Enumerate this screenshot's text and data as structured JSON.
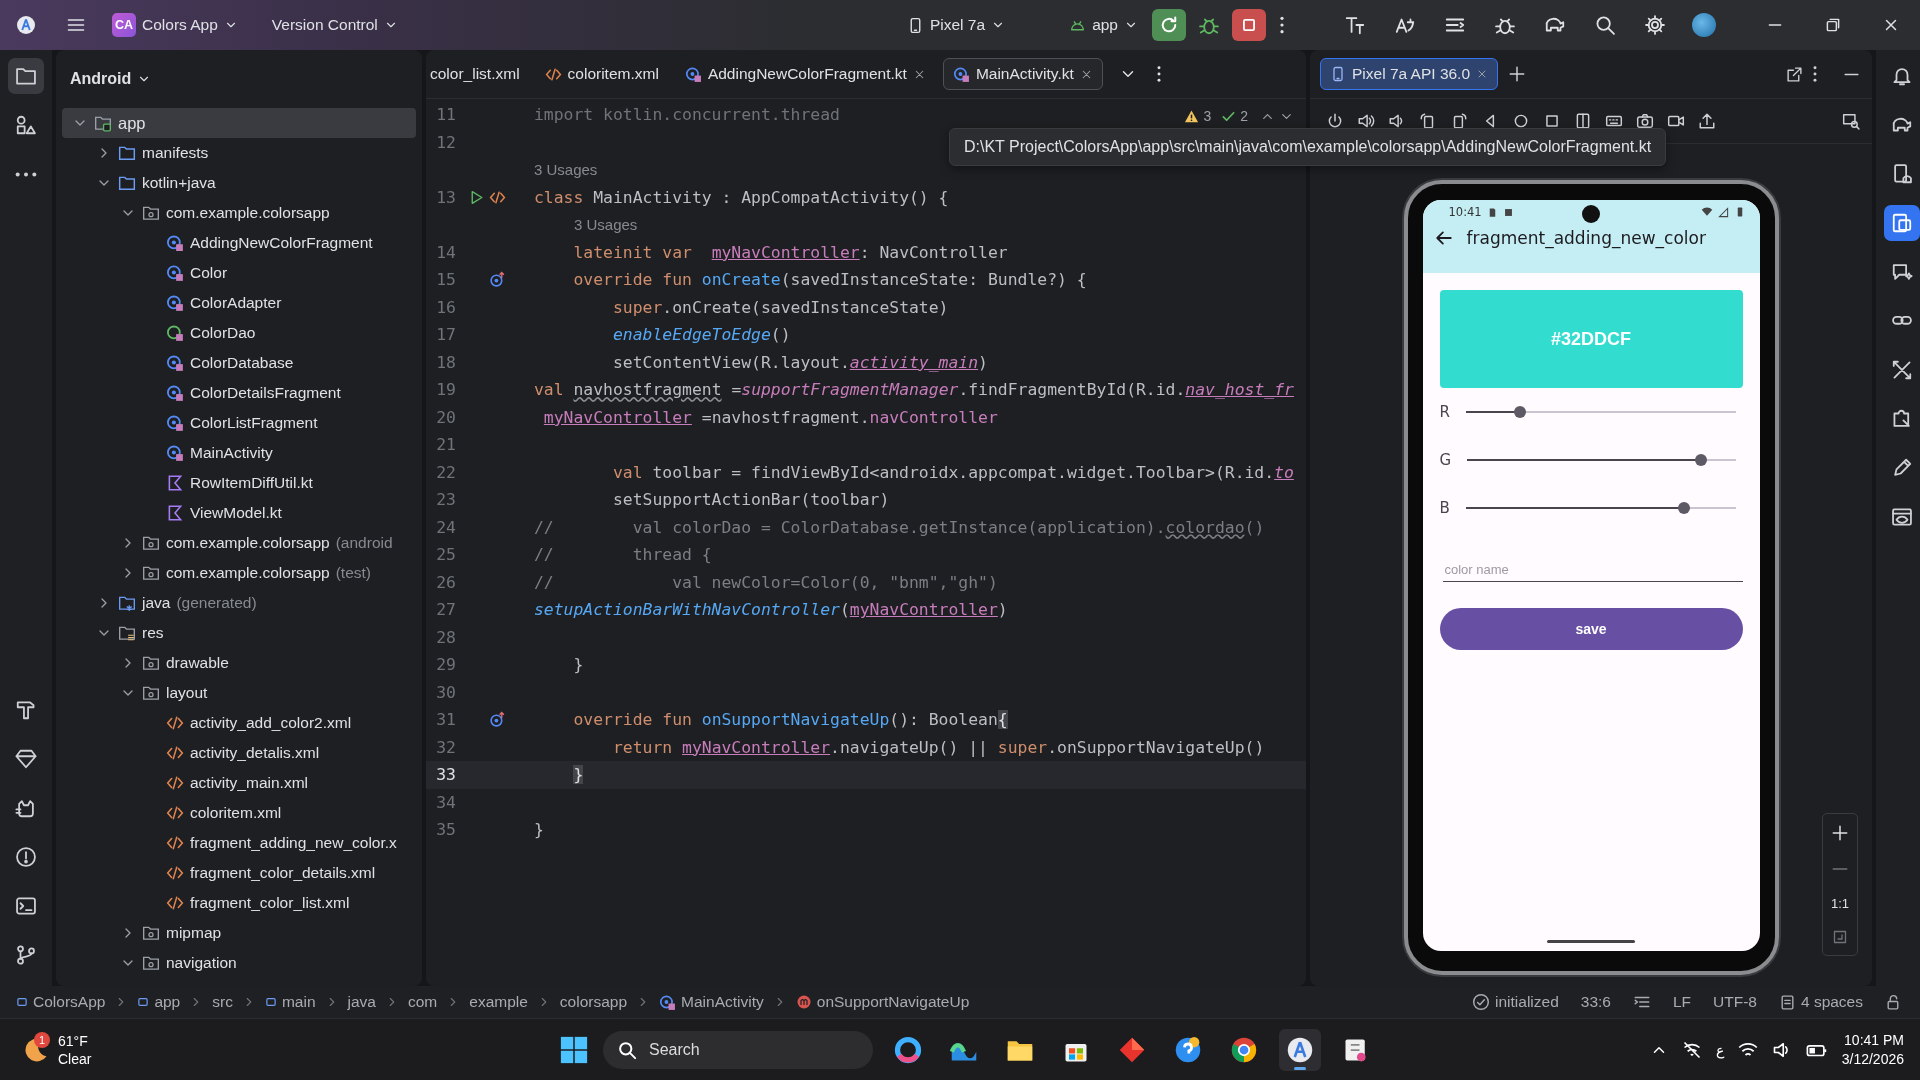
{
  "title_bar": {
    "project_badge": "CA",
    "project": "Colors App",
    "vcs": "Version Control",
    "device": "Pixel 7a",
    "run_config": "app"
  },
  "left_toolbar": {
    "top": [
      {
        "kind": "folder",
        "selected": true
      },
      {
        "kind": "structure",
        "selected": false
      },
      {
        "kind": "more",
        "selected": false
      }
    ],
    "bottom": [
      {
        "kind": "build",
        "selected": false
      },
      {
        "kind": "gem",
        "selected": false
      },
      {
        "kind": "logcat",
        "selected": false
      },
      {
        "kind": "problems",
        "selected": false
      },
      {
        "kind": "terminal",
        "selected": false
      },
      {
        "kind": "git",
        "selected": false
      }
    ]
  },
  "right_toolbar": [
    {
      "kind": "bell",
      "selected": false
    },
    {
      "kind": "elephant",
      "selected": false
    },
    {
      "kind": "device",
      "selected": false
    },
    {
      "kind": "devices",
      "selected": true
    },
    {
      "kind": "chat",
      "selected": false
    },
    {
      "kind": "link",
      "selected": false
    },
    {
      "kind": "tools",
      "selected": false
    },
    {
      "kind": "puzzle",
      "selected": false
    },
    {
      "kind": "pencil",
      "selected": false
    },
    {
      "kind": "eye",
      "selected": false
    }
  ],
  "project": {
    "view": "Android",
    "tree": [
      {
        "label": "app",
        "kind": "module",
        "expanded": true,
        "selected": true,
        "children": [
          {
            "label": "manifests",
            "kind": "folder",
            "expanded": false,
            "selected": false
          },
          {
            "label": "kotlin+java",
            "kind": "folder",
            "expanded": true,
            "selected": false,
            "children": [
              {
                "label": "com.example.colorsapp",
                "kind": "package",
                "expanded": true,
                "selected": false,
                "children": [
                  {
                    "label": "AddingNewColorFragment",
                    "kind": "class",
                    "selected": false
                  },
                  {
                    "label": "Color",
                    "kind": "class",
                    "selected": false
                  },
                  {
                    "label": "ColorAdapter",
                    "kind": "class",
                    "selected": false
                  },
                  {
                    "label": "ColorDao",
                    "kind": "interface",
                    "selected": false
                  },
                  {
                    "label": "ColorDatabase",
                    "kind": "class",
                    "selected": false
                  },
                  {
                    "label": "ColorDetailsFragment",
                    "kind": "class",
                    "selected": false
                  },
                  {
                    "label": "ColorListFragment",
                    "kind": "class",
                    "selected": false
                  },
                  {
                    "label": "MainActivity",
                    "kind": "class",
                    "selected": false
                  },
                  {
                    "label": "RowItemDiffUtil.kt",
                    "kind": "kotlin-file",
                    "selected": false
                  },
                  {
                    "label": "ViewModel.kt",
                    "kind": "kotlin-file",
                    "selected": false
                  }
                ]
              },
              {
                "label": "com.example.colorsapp",
                "suffix": "(android",
                "kind": "package",
                "expanded": false,
                "selected": false
              },
              {
                "label": "com.example.colorsapp",
                "suffix": "(test)",
                "kind": "package",
                "expanded": false,
                "selected": false
              }
            ]
          },
          {
            "label": "java",
            "suffix": "(generated)",
            "kind": "generated",
            "expanded": false,
            "selected": false
          },
          {
            "label": "res",
            "kind": "resources",
            "expanded": true,
            "selected": false,
            "children": [
              {
                "label": "drawable",
                "kind": "package",
                "expanded": false,
                "selected": false
              },
              {
                "label": "layout",
                "kind": "package",
                "expanded": true,
                "selected": false,
                "children": [
                  {
                    "label": "activity_add_color2.xml",
                    "kind": "xml",
                    "selected": false
                  },
                  {
                    "label": "activity_detalis.xml",
                    "kind": "xml",
                    "selected": false
                  },
                  {
                    "label": "activity_main.xml",
                    "kind": "xml",
                    "selected": false
                  },
                  {
                    "label": "coloritem.xml",
                    "kind": "xml",
                    "selected": false
                  },
                  {
                    "label": "fragment_adding_new_color.x",
                    "kind": "xml",
                    "selected": false
                  },
                  {
                    "label": "fragment_color_details.xml",
                    "kind": "xml",
                    "selected": false
                  },
                  {
                    "label": "fragment_color_list.xml",
                    "kind": "xml",
                    "selected": false
                  }
                ]
              },
              {
                "label": "mipmap",
                "kind": "package",
                "expanded": false,
                "selected": false
              },
              {
                "label": "navigation",
                "kind": "package",
                "expanded": true,
                "selected": false
              }
            ]
          }
        ]
      }
    ]
  },
  "editor": {
    "tabs": [
      {
        "label": "color_list.xml",
        "kind": "plain",
        "closable": false,
        "selected": false
      },
      {
        "label": "coloritem.xml",
        "kind": "xml",
        "closable": false,
        "selected": false
      },
      {
        "label": "AddingNewColorFragment.kt",
        "kind": "class",
        "closable": true,
        "selected": false
      },
      {
        "label": "MainActivity.kt",
        "kind": "class",
        "closable": true,
        "selected": true
      }
    ],
    "inspections": {
      "warnings": "3",
      "checks": "2"
    },
    "tooltip": "D:\\KT Project\\ColorsApp\\app\\src\\main\\java\\com\\example\\colorsapp\\AddingNewColorFragment.kt",
    "lines": [
      {
        "kind": "code",
        "number": "11",
        "current": false,
        "segments": [
          {
            "kind": "dim",
            "text": "import kotlin.concurrent.thread"
          }
        ]
      },
      {
        "kind": "code",
        "number": "12",
        "current": false
      },
      {
        "kind": "hint",
        "text": "3 Usages"
      },
      {
        "kind": "code",
        "number": "13",
        "current": false,
        "gutter": {
          "kind": "run"
        },
        "segments": [
          {
            "kind": "kw",
            "text": "class "
          },
          {
            "kind": "plain",
            "text": "MainActivity : AppCompatActivity() {"
          }
        ]
      },
      {
        "kind": "hint",
        "indent": {
          "kind": "nested"
        },
        "text": "3 Usages"
      },
      {
        "kind": "code",
        "number": "14",
        "current": false,
        "segments": [
          {
            "kind": "kw",
            "text": "    lateinit var  "
          },
          {
            "kind": "propu",
            "text": "myNavController"
          },
          {
            "kind": "plain",
            "text": ": NavController"
          }
        ]
      },
      {
        "kind": "code",
        "number": "15",
        "current": false,
        "gutter": {
          "kind": "override"
        },
        "segments": [
          {
            "kind": "kw",
            "text": "    override fun "
          },
          {
            "kind": "fn",
            "text": "onCreate"
          },
          {
            "kind": "plain",
            "text": "(savedInstanceState: Bundle?) {"
          }
        ]
      },
      {
        "kind": "code",
        "number": "16",
        "current": false,
        "segments": [
          {
            "kind": "kw",
            "text": "        super"
          },
          {
            "kind": "plain",
            "text": ".onCreate(savedInstanceState)"
          }
        ]
      },
      {
        "kind": "code",
        "number": "17",
        "current": false,
        "segments": [
          {
            "kind": "ifn",
            "text": "        enableEdgeToEdge"
          },
          {
            "kind": "plain",
            "text": "()"
          }
        ]
      },
      {
        "kind": "code",
        "number": "18",
        "current": false,
        "segments": [
          {
            "kind": "plain",
            "text": "        setContentView(R.layout."
          },
          {
            "kind": "ipropu",
            "text": "activity_main"
          },
          {
            "kind": "plain",
            "text": ")"
          }
        ]
      },
      {
        "kind": "code",
        "number": "19",
        "current": false,
        "segments": [
          {
            "kind": "kw",
            "text": "val "
          },
          {
            "kind": "wavy",
            "text": "navhostfragment"
          },
          {
            "kind": "plain",
            "text": " ="
          },
          {
            "kind": "iprop",
            "text": "supportFragmentManager"
          },
          {
            "kind": "plain",
            "text": ".findFragmentById(R.id."
          },
          {
            "kind": "ipropu",
            "text": "nav_host_fr"
          }
        ]
      },
      {
        "kind": "code",
        "number": "20",
        "current": false,
        "lead": {
          "kind": "space"
        },
        "segments": [
          {
            "kind": "propu",
            "text": "myNavController"
          },
          {
            "kind": "plain",
            "text": " =navhostfragment."
          },
          {
            "kind": "prop",
            "text": "navController"
          }
        ]
      },
      {
        "kind": "code",
        "number": "21",
        "current": false
      },
      {
        "kind": "code",
        "number": "22",
        "current": false,
        "segments": [
          {
            "kind": "kw",
            "text": "        val "
          },
          {
            "kind": "plain",
            "text": "toolbar = findViewById<androidx.appcompat.widget.Toolbar>(R.id."
          },
          {
            "kind": "ipropu",
            "text": "to"
          }
        ]
      },
      {
        "kind": "code",
        "number": "23",
        "current": false,
        "segments": [
          {
            "kind": "plain",
            "text": "        setSupportActionBar(toolbar)"
          }
        ]
      },
      {
        "kind": "code",
        "number": "24",
        "current": false,
        "segments": [
          {
            "kind": "comment",
            "text": "//        val colorDao = ColorDatabase.getInstance(application)."
          },
          {
            "kind": "wavyc",
            "text": "colordao"
          },
          {
            "kind": "comment",
            "text": "()"
          }
        ]
      },
      {
        "kind": "code",
        "number": "25",
        "current": false,
        "segments": [
          {
            "kind": "comment",
            "text": "//        thread {"
          }
        ]
      },
      {
        "kind": "code",
        "number": "26",
        "current": false,
        "segments": [
          {
            "kind": "comment",
            "text": "//            val newColor=Color(0, \"bnm\",\"gh\")"
          }
        ]
      },
      {
        "kind": "code",
        "number": "27",
        "current": false,
        "segments": [
          {
            "kind": "ifn",
            "text": "setupActionBarWithNavController"
          },
          {
            "kind": "plain",
            "text": "("
          },
          {
            "kind": "propu",
            "text": "myNavController"
          },
          {
            "kind": "plain",
            "text": ")"
          }
        ]
      },
      {
        "kind": "code",
        "number": "28",
        "current": false
      },
      {
        "kind": "code",
        "number": "29",
        "current": false,
        "segments": [
          {
            "kind": "plain",
            "text": "    }"
          }
        ]
      },
      {
        "kind": "code",
        "number": "30",
        "current": false
      },
      {
        "kind": "code",
        "number": "31",
        "current": false,
        "gutter": {
          "kind": "override"
        },
        "segments": [
          {
            "kind": "kw",
            "text": "    override fun "
          },
          {
            "kind": "fn",
            "text": "onSupportNavigateUp"
          },
          {
            "kind": "plain",
            "text": "(): Boolean"
          },
          {
            "kind": "brace",
            "text": "{"
          }
        ]
      },
      {
        "kind": "code",
        "number": "32",
        "current": false,
        "segments": [
          {
            "kind": "kw",
            "text": "        return "
          },
          {
            "kind": "propu",
            "text": "myNavController"
          },
          {
            "kind": "plain",
            "text": ".navigateUp() || "
          },
          {
            "kind": "kw",
            "text": "super"
          },
          {
            "kind": "plain",
            "text": ".onSupportNavigateUp()"
          }
        ]
      },
      {
        "kind": "code",
        "number": "33",
        "current": true,
        "lead": {
          "kind": "tab"
        },
        "segments": [
          {
            "kind": "brace",
            "text": "}"
          }
        ]
      },
      {
        "kind": "code",
        "number": "34",
        "current": false
      },
      {
        "kind": "code",
        "number": "35",
        "current": false,
        "segments": [
          {
            "kind": "plain",
            "text": "}"
          }
        ]
      }
    ]
  },
  "emulator": {
    "tab": "Pixel 7a API 36.0",
    "zoom_fit": "1:1",
    "device": {
      "time": "10:41",
      "title": "fragment_adding_new_color",
      "preview": {
        "label": "#32DDCF",
        "color": "#32ddcf"
      },
      "sliders": [
        {
          "label": "R",
          "level": 0.2
        },
        {
          "label": "G",
          "level": 0.87
        },
        {
          "label": "B",
          "level": 0.81
        }
      ],
      "field": {
        "placeholder": "color name"
      },
      "button": "save"
    }
  },
  "status_bar": {
    "breadcrumbs": [
      {
        "label": "ColorsApp",
        "kind": "module"
      },
      {
        "label": "app",
        "kind": "module"
      },
      {
        "label": "src",
        "kind": "plain"
      },
      {
        "label": "main",
        "kind": "module"
      },
      {
        "label": "java",
        "kind": "plain"
      },
      {
        "label": "com",
        "kind": "plain"
      },
      {
        "label": "example",
        "kind": "plain"
      },
      {
        "label": "colorsapp",
        "kind": "plain"
      },
      {
        "label": "MainActivity",
        "kind": "class"
      },
      {
        "label": "onSupportNavigateUp",
        "kind": "method"
      }
    ],
    "status": "initialized",
    "position": "33:6",
    "line_ending": "LF",
    "encoding": "UTF-8",
    "indent": "4 spaces"
  },
  "taskbar": {
    "weather": {
      "temp": "61°F",
      "condition": "Clear",
      "badge": "1"
    },
    "search": "Search",
    "apps": [
      {
        "kind": "ring",
        "selected": false
      },
      {
        "kind": "wave",
        "selected": false
      },
      {
        "kind": "folder",
        "selected": false
      },
      {
        "kind": "bag",
        "selected": false
      },
      {
        "kind": "diamond",
        "selected": false
      },
      {
        "kind": "help",
        "selected": false
      },
      {
        "kind": "globe",
        "selected": false
      },
      {
        "kind": "studio",
        "selected": true
      },
      {
        "kind": "snip",
        "selected": false
      }
    ],
    "language": "ع",
    "time": "10:41 PM",
    "date": "3/12/2026"
  }
}
